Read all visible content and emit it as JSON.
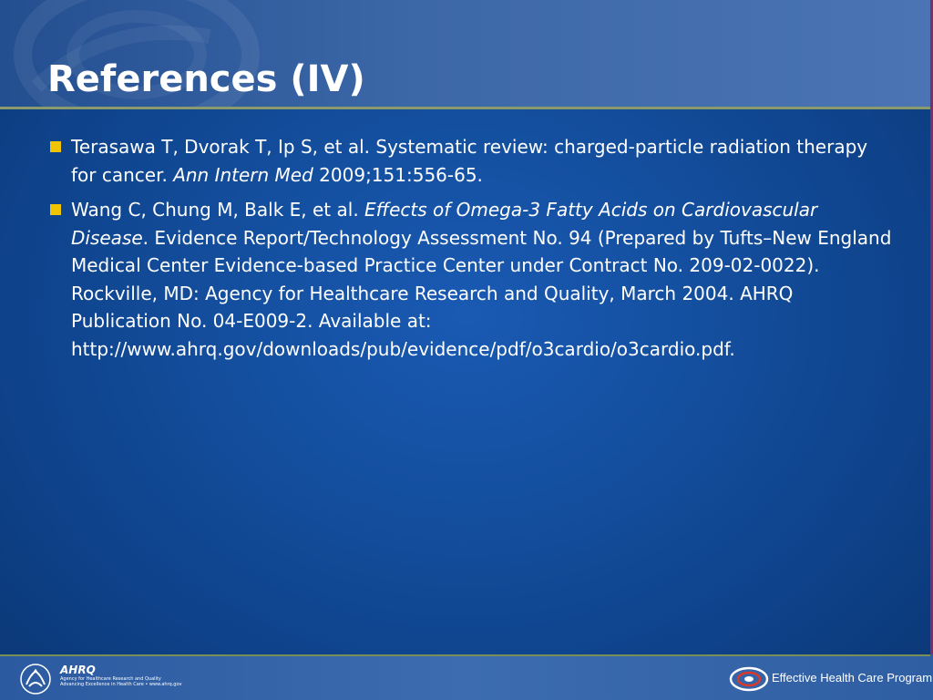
{
  "slide": {
    "title": "References (IV)",
    "references": [
      {
        "part1": "Terasawa T, Dvorak T, Ip S, et al. Systematic review: charged-particle radiation therapy for cancer. ",
        "italic": "Ann Intern Med",
        "part2": " 2009;151:556-65."
      },
      {
        "part1": "Wang C, Chung M, Balk E, et al. ",
        "italic": "Effects of Omega-3 Fatty Acids on Cardiovascular Disease",
        "part2": ". Evidence Report/Technology Assessment No. 94 (Prepared by Tufts–New England Medical Center Evidence-based Practice Center under Contract No. 209-02-0022). Rockville, MD: Agency for Healthcare Research and Quality, March 2004. AHRQ Publication No. 04-E009-2. Available at: http://www.ahrq.gov/downloads/pub/evidence/pdf/o3cardio/o3cardio.pdf."
      }
    ]
  },
  "footer": {
    "ahrq_logo_text": "AHRQ",
    "ahrq_tagline": "Agency for Healthcare Research and Quality",
    "ahrq_subtagline": "Advancing Excellence in Health Care • www.ahrq.gov",
    "program_name": "Effective Health Care Program"
  },
  "colors": {
    "bullet": "#f0c400",
    "title_band": "#3d68a8",
    "background": "#144f9f",
    "rule": "#8a9a6a"
  },
  "icons": {
    "bullet": "square-bullet-icon",
    "hhs": "hhs-eagle-logo-icon",
    "program": "effective-health-care-logo-icon"
  }
}
